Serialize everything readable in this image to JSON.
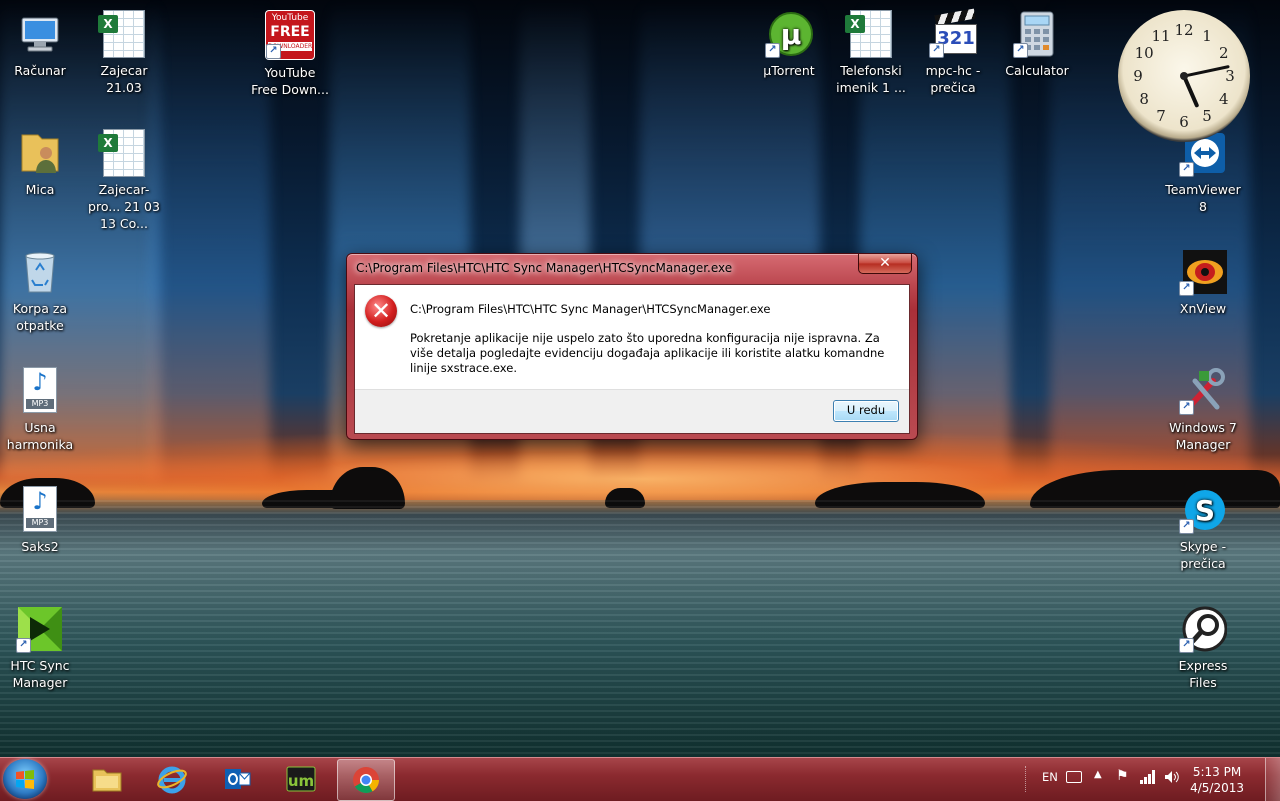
{
  "desktop": {
    "icons": {
      "racunar": "Računar",
      "zajecar": "Zajecar 21.03",
      "youtube": "YouTube Free Down...",
      "mica": "Mica",
      "zajecar_pro": "Zajecar-pro... 21 03 13 Co...",
      "korpa": "Korpa za otpatke",
      "usna": "Usna harmonika",
      "saks2": "Saks2",
      "htc": "HTC Sync Manager",
      "utorrent": "µTorrent",
      "telefonski": "Telefonski imenik 1 ...",
      "mpc": "mpc-hc - prečica",
      "calculator": "Calculator",
      "teamviewer": "TeamViewer 8",
      "xnview": "XnView",
      "win7": "Windows 7 Manager",
      "skype": "Skype - prečica",
      "express": "Express Files"
    },
    "icon_badges": {
      "youtube_line1": "YouTube",
      "youtube_line2": "FREE",
      "youtube_line3": "DOWNLOADER",
      "xl": "X",
      "mp3": "MP3",
      "mpc": "321",
      "um": "um"
    }
  },
  "clock_gadget": {
    "numbers": [
      "12",
      "1",
      "2",
      "3",
      "4",
      "5",
      "6",
      "7",
      "8",
      "9",
      "10",
      "11"
    ],
    "hour": 5,
    "minute": 13
  },
  "dialog": {
    "title": "C:\\Program Files\\HTC\\HTC Sync Manager\\HTCSyncManager.exe",
    "close_label": "✕",
    "heading": "C:\\Program Files\\HTC\\HTC Sync Manager\\HTCSyncManager.exe",
    "message": "Pokretanje aplikacije nije uspelo zato što uporedna konfiguracija nije ispravna. Za više detalja pogledajte evidenciju događaja aplikacije ili koristite alatku komandne linije sxstrace.exe.",
    "ok_label": "U redu",
    "error_glyph": "✕"
  },
  "taskbar": {
    "language": "EN",
    "time": "5:13 PM",
    "date": "4/5/2013",
    "pinned": [
      "explorer-icon",
      "internet-explorer-icon",
      "outlook-icon",
      "um-icon",
      "chrome-icon"
    ]
  },
  "colors": {
    "taskbar": "#8b2a2f",
    "dialog_frame": "#b94a51",
    "ok_border": "#3c7fb1"
  }
}
